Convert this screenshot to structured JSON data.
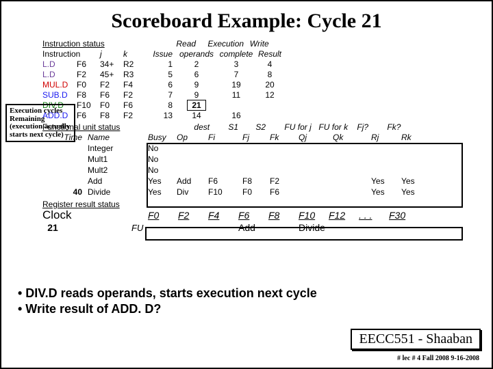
{
  "title": "Scoreboard Example:  Cycle 21",
  "instr_status": {
    "heading": "Instruction status",
    "cols": {
      "instr": "Instruction",
      "j": "j",
      "k": "k",
      "issue": "Issue",
      "read": "Read operands",
      "exec": "Execution complete",
      "write": "Write Result"
    },
    "rows": [
      {
        "op": "L.D",
        "reg": "F6",
        "j": "34+",
        "k": "R2",
        "issue": "1",
        "read": "2",
        "exec": "3",
        "write": "4",
        "cls": "purple"
      },
      {
        "op": "L.D",
        "reg": "F2",
        "j": "45+",
        "k": "R3",
        "issue": "5",
        "read": "6",
        "exec": "7",
        "write": "8",
        "cls": "purple"
      },
      {
        "op": "MUL.D",
        "reg": "F0",
        "j": "F2",
        "k": "F4",
        "issue": "6",
        "read": "9",
        "exec": "19",
        "write": "20",
        "cls": "red"
      },
      {
        "op": "SUB.D",
        "reg": "F8",
        "j": "F6",
        "k": "F2",
        "issue": "7",
        "read": "9",
        "exec": "11",
        "write": "12",
        "cls": "blue"
      },
      {
        "op": "DIV.D",
        "reg": "F10",
        "j": "F0",
        "k": "F6",
        "issue": "8",
        "read": "21",
        "exec": "",
        "write": "",
        "cls": "green",
        "box_read": true
      },
      {
        "op": "ADD.D",
        "reg": "F6",
        "j": "F8",
        "k": "F2",
        "issue": "13",
        "read": "14",
        "exec": "16",
        "write": "",
        "cls": "blue"
      }
    ]
  },
  "fu_status": {
    "heading": "Functional unit status",
    "cols": {
      "time": "Time",
      "name": "Name",
      "busy": "Busy",
      "op": "Op",
      "dest": "dest",
      "fi": "Fi",
      "s1": "S1",
      "fj": "Fj",
      "s2": "S2",
      "fk": "Fk",
      "fuj": "FU for j",
      "qj": "Qj",
      "fuk": "FU for k",
      "qk": "Qk",
      "rj_h": "Fj?",
      "rj": "Rj",
      "rk_h": "Fk?",
      "rk": "Rk"
    },
    "rows": [
      {
        "time": "",
        "name": "Integer",
        "busy": "No",
        "op": "",
        "fi": "",
        "fj": "",
        "fk": "",
        "qj": "",
        "qk": "",
        "rj": "",
        "rk": ""
      },
      {
        "time": "",
        "name": "Mult1",
        "busy": "No",
        "op": "",
        "fi": "",
        "fj": "",
        "fk": "",
        "qj": "",
        "qk": "",
        "rj": "",
        "rk": ""
      },
      {
        "time": "",
        "name": "Mult2",
        "busy": "No",
        "op": "",
        "fi": "",
        "fj": "",
        "fk": "",
        "qj": "",
        "qk": "",
        "rj": "",
        "rk": ""
      },
      {
        "time": "",
        "name": "Add",
        "busy": "Yes",
        "op": "Add",
        "fi": "F6",
        "fj": "F8",
        "fk": "F2",
        "qj": "",
        "qk": "",
        "rj": "Yes",
        "rk": "Yes"
      },
      {
        "time": "40",
        "name": "Divide",
        "busy": "Yes",
        "op": "Div",
        "fi": "F10",
        "fj": "F0",
        "fk": "F6",
        "qj": "",
        "qk": "",
        "rj": "Yes",
        "rk": "Yes"
      }
    ]
  },
  "exec_note": "Execution cycles Remaining (execution actually starts next cycle)",
  "reg_status": {
    "heading": "Register result status",
    "clock_label": "Clock",
    "clock_value": "21",
    "fu_label": "FU",
    "regs": [
      "F0",
      "F2",
      "F4",
      "F6",
      "F8",
      "F10",
      "F12",
      ". . .",
      "F30"
    ],
    "vals": [
      "",
      "",
      "",
      "Add",
      "",
      "Divide",
      "",
      "",
      ""
    ]
  },
  "bullets": [
    "• DIV.D reads operands, starts execution next cycle",
    "• Write result of ADD. D?"
  ],
  "footer": {
    "course": "EECC551 - Shaaban",
    "small": "#  lec # 4   Fall 2008    9-16-2008"
  }
}
